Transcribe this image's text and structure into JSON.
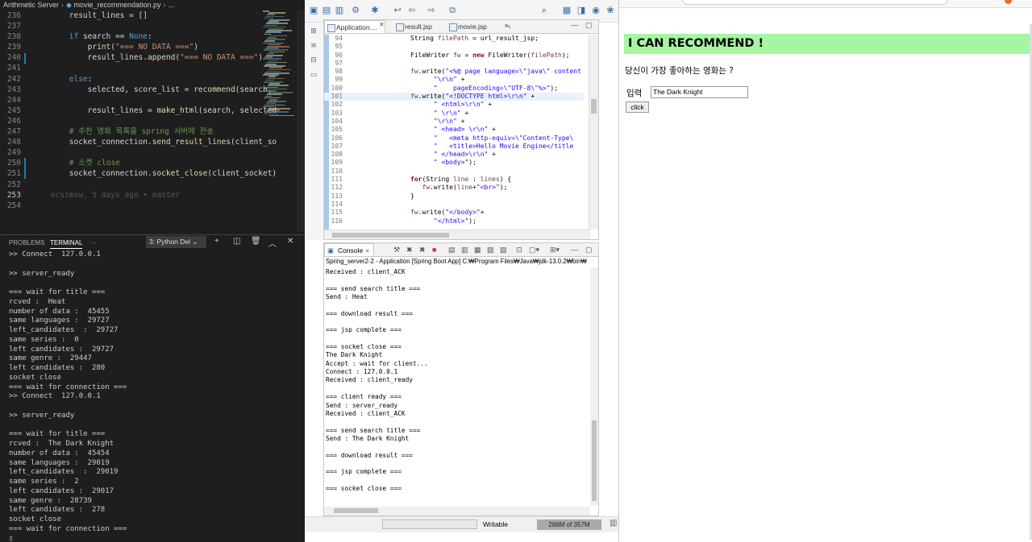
{
  "vscode": {
    "breadcrumb": [
      "Arithmetic Server",
      "movie_recommendation.py",
      "..."
    ],
    "code_lines": [
      {
        "n": "236",
        "html": "        result_lines = []"
      },
      {
        "n": "237",
        "html": ""
      },
      {
        "n": "238",
        "html": "        <span class=\"k\">if</span> search == <span class=\"k\">None</span>:"
      },
      {
        "n": "239",
        "html": "            <span class=\"f\">print</span>(<span class=\"s\">\"=== NO DATA ===\"</span>)"
      },
      {
        "n": "240",
        "html": "            result_lines.<span class=\"f\">append</span>(<span class=\"s\">\"=== NO DATA ===\"</span>)"
      },
      {
        "n": "241",
        "html": ""
      },
      {
        "n": "242",
        "html": "        <span class=\"k\">else</span>:"
      },
      {
        "n": "243",
        "html": "            selected, score_list = <span class=\"f\">recommend</span>(search,"
      },
      {
        "n": "244",
        "html": ""
      },
      {
        "n": "245",
        "html": "            result_lines = <span class=\"f\">make_html</span>(search, selected"
      },
      {
        "n": "246",
        "html": ""
      },
      {
        "n": "247",
        "html": "        <span class=\"c\"># 추천 영화 목록을 spring 서버에 전송</span>"
      },
      {
        "n": "248",
        "html": "        socket_connection.<span class=\"f\">send_result_lines</span>(client_so"
      },
      {
        "n": "249",
        "html": ""
      },
      {
        "n": "250",
        "html": "        <span class=\"c\"># 소켓 close</span>"
      },
      {
        "n": "251",
        "html": "        socket_connection.<span class=\"f\">socket_close</span>(client_socket)"
      },
      {
        "n": "252",
        "html": ""
      },
      {
        "n": "253",
        "html": "    <span class=\"blame\">ecsimsw, 5 days ago • master</span>"
      },
      {
        "n": "254",
        "html": ""
      }
    ],
    "panel_tabs": [
      "PROBLEMS",
      "TERMINAL",
      "···"
    ],
    "terminal_select": "3: Python Del",
    "terminal_lines": [
      ">> Connect  127.0.0.1",
      "",
      ">> server_ready",
      "",
      "=== wait for title ===",
      "rcved :  Heat",
      "number of data :  45455",
      "same languages :  29727",
      "left_candidates  :  29727",
      "same series :  0",
      "left candidates :  29727",
      "same genre :  29447",
      "left candidates :  280",
      "socket close",
      "=== wait for connection ===",
      ">> Connect  127.0.0.1",
      "",
      ">> server_ready",
      "",
      "=== wait for title ===",
      "rcved :  The Dark Knight",
      "number of data :  45454",
      "same languages :  29019",
      "left_candidates  :  29019",
      "same series :  2",
      "left candidates :  29017",
      "same genre :  28739",
      "left candidates :  278",
      "socket close",
      "=== wait for connection ===",
      "▯"
    ]
  },
  "eclipse": {
    "tabs": [
      "Application....",
      "result.jsp",
      "movie.jsp",
      "»₁"
    ],
    "code_lines": [
      {
        "n": "94",
        "html": "String <span class=\"jf\">filePath</span> = url_result_jsp;",
        "hl": false
      },
      {
        "n": "95",
        "html": "",
        "hl": false
      },
      {
        "n": "96",
        "html": "FileWriter <span class=\"jf\">fw</span> = <span class=\"jk\">new</span> FileWriter(<span class=\"jf\">filePath</span>);",
        "hl": false
      },
      {
        "n": "97",
        "html": "",
        "hl": false
      },
      {
        "n": "98",
        "html": "<span class=\"jf\">fw</span>.write(<span class=\"js\">\"&lt;%@ page language=\\\"java\\\" content</span>",
        "hl": false
      },
      {
        "n": "99",
        "html": "      <span class=\"js\">\"\\r\\n\"</span> +",
        "hl": false
      },
      {
        "n": "100",
        "html": "      <span class=\"js\">\"    pageEncoding=\\\"UTF-8\\\"%&gt;\"</span>);",
        "hl": false
      },
      {
        "n": "101",
        "html": "<span class=\"jf\">fw</span>.write(<span class=\"js\">\"&lt;!DOCTYPE html&gt;\\r\\n\"</span> +",
        "hl": true
      },
      {
        "n": "102",
        "html": "      <span class=\"js\">\" &lt;html&gt;\\r\\n\"</span> +",
        "hl": false
      },
      {
        "n": "103",
        "html": "      <span class=\"js\">\" \\r\\n\"</span> +",
        "hl": false
      },
      {
        "n": "104",
        "html": "      <span class=\"js\">\"\\r\\n\"</span> +",
        "hl": false
      },
      {
        "n": "105",
        "html": "      <span class=\"js\">\" &lt;head&gt; \\r\\n\"</span> +",
        "hl": false
      },
      {
        "n": "106",
        "html": "      <span class=\"js\">\"   &lt;meta http-equiv=\\\"Content-Type\\</span>",
        "hl": false
      },
      {
        "n": "107",
        "html": "      <span class=\"js\">\"   &lt;title&gt;Hello Movie Engine&lt;/title</span>",
        "hl": false
      },
      {
        "n": "108",
        "html": "      <span class=\"js\">\" &lt;/head&gt;\\r\\n\"</span> +",
        "hl": false
      },
      {
        "n": "109",
        "html": "      <span class=\"js\">\" &lt;body&gt;\"</span>);",
        "hl": false
      },
      {
        "n": "110",
        "html": "",
        "hl": false
      },
      {
        "n": "111",
        "html": "<span class=\"jk\">for</span>(String <span class=\"jf\">line</span> : <span class=\"jf\">lines</span>) {",
        "hl": false
      },
      {
        "n": "112",
        "html": "   <span class=\"jf\">fw</span>.write(<span class=\"jf\">line</span>+<span class=\"js\">\"&lt;br&gt;\"</span>);",
        "hl": false
      },
      {
        "n": "113",
        "html": "}",
        "hl": false
      },
      {
        "n": "114",
        "html": "",
        "hl": false
      },
      {
        "n": "115",
        "html": "<span class=\"jf\">fw</span>.write(<span class=\"js\">\"&lt;/body&gt;\"</span>+",
        "hl": false
      },
      {
        "n": "116",
        "html": "      <span class=\"js\">\"&lt;/html&gt;\"</span>);",
        "hl": false
      }
    ],
    "console_title": "Console",
    "console_path": "Spring_server2-2 - Application [Spring Boot App] C:₩Program Files₩Java₩jdk-13.0.2₩bin₩",
    "console_lines": [
      "Received : client_ACK",
      "",
      "=== send search title ===",
      "Send : Heat",
      "",
      "=== download result ===",
      "",
      "=== jsp complete ===",
      "",
      "=== socket close ===",
      "The Dark Knight",
      "Accept : wait for client...",
      "Connect : 127.0.0.1",
      "Received : client_ready",
      "",
      "=== client ready ===",
      "Send : server_ready",
      "Received : client_ACK",
      "",
      "=== send search title ===",
      "Send : The Dark Knight",
      "",
      "=== download result ===",
      "",
      "=== jsp complete ===",
      "",
      "=== socket close ==="
    ],
    "status_writable": "Writable",
    "status_memory": "286M of 357M"
  },
  "web": {
    "banner": "I CAN RECOMMEND !",
    "question": "당신이 가장 좋아하는 영화는 ?",
    "input_label": "입력",
    "input_value": "The Dark Knight",
    "button": "click"
  },
  "colors": {
    "vscode_bg": "#1e1e1e",
    "banner_bg": "#a6f5a2",
    "eclipse_keyword": "#7f0055",
    "eclipse_string": "#2a00ff"
  }
}
